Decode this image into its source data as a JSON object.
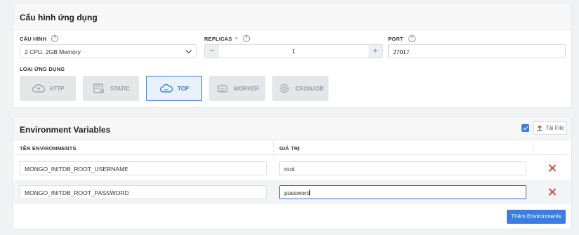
{
  "config": {
    "title": "Cấu hình ứng dụng",
    "config_label": "CẤU HÌNH",
    "config_value": "2 CPU, 2GB Memory",
    "replicas_label": "REPLICAS",
    "replicas_required": "*",
    "replicas_value": "1",
    "minus": "−",
    "plus": "+",
    "port_label": "PORT",
    "port_value": "27017",
    "app_type_label": "LOẠI ỨNG DỤNG",
    "help": "?",
    "app_types": [
      {
        "label": "HTTP",
        "icon": "cloud-upload-icon"
      },
      {
        "label": "STATIC",
        "icon": "static-page-icon"
      },
      {
        "label": "TCP",
        "icon": "cloud-tcp-icon",
        "selected": true
      },
      {
        "label": "WORKER",
        "icon": "worker-icon"
      },
      {
        "label": "CRONJOB",
        "icon": "gear-icon"
      }
    ]
  },
  "env": {
    "title": "Environment Variables",
    "upload_label": "Tải File",
    "col_name": "TÊN ENVIRONMENTS",
    "col_value": "GIÁ TRỊ",
    "rows": [
      {
        "name": "MONGO_INITDB_ROOT_USERNAME",
        "value": "root"
      },
      {
        "name": "MONGO_INITDB_ROOT_PASSWORD",
        "value": "password"
      }
    ],
    "add_label": "Thêm Environments"
  },
  "colors": {
    "accent": "#3b7de0",
    "danger": "#e04a3a",
    "selected_bg": "#e9f1fc",
    "disabled_bg": "#e5e6e8"
  }
}
